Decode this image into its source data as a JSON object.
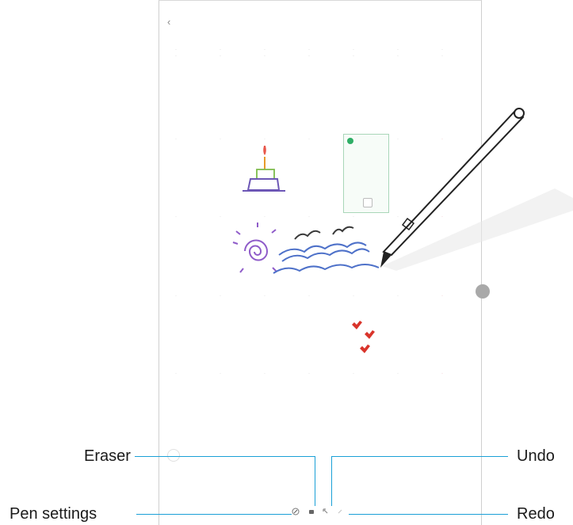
{
  "tablet": {
    "back_icon": "‹",
    "month_title": "",
    "top_action": "",
    "accent_green": "#2fae66",
    "weekend_red": "#e8a0a6"
  },
  "callouts": {
    "eraser": "Eraser",
    "pen_settings": "Pen settings",
    "undo": "Undo",
    "redo": "Redo",
    "color": "#1aa0d7"
  },
  "toolbar": {
    "icons": [
      "pen-settings-icon",
      "eraser-icon",
      "undo-icon",
      "redo-icon"
    ]
  }
}
